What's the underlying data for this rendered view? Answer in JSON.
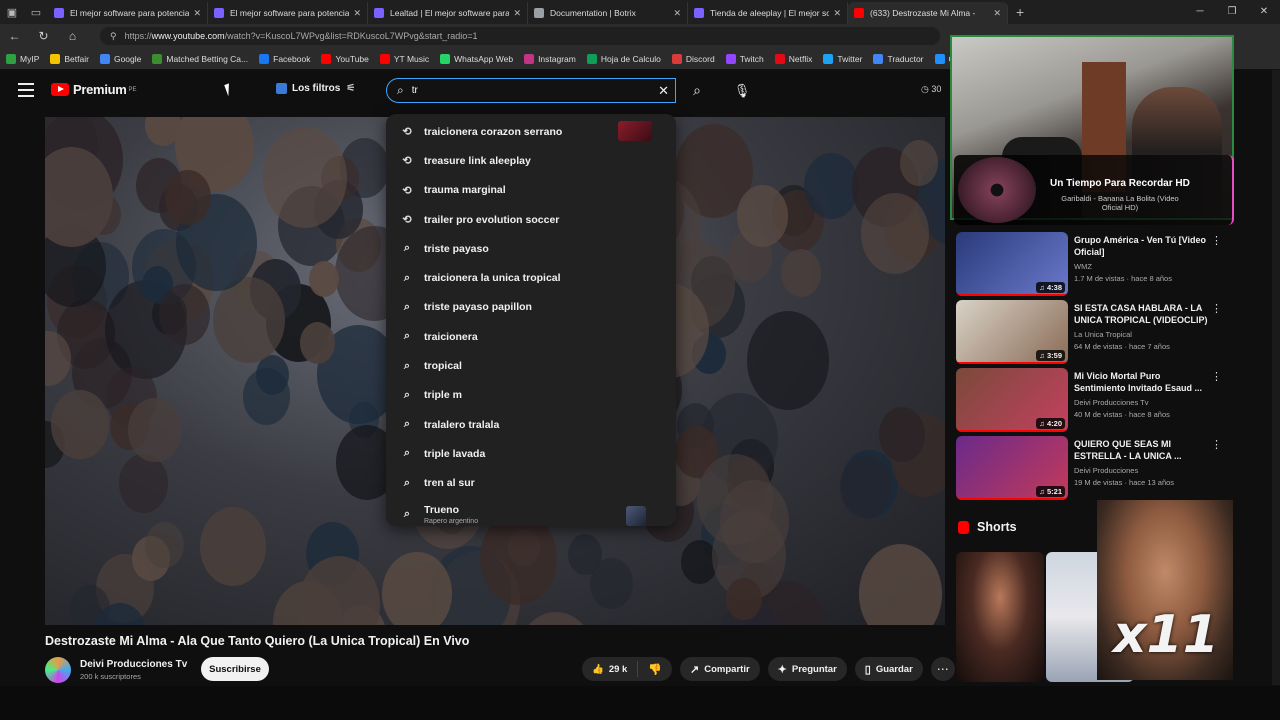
{
  "tabs": [
    {
      "title": "El mejor software para potenciar",
      "color": "#7b61ff"
    },
    {
      "title": "El mejor software para potenciar",
      "color": "#7b61ff"
    },
    {
      "title": "Lealtad | El mejor software para p",
      "color": "#7b61ff"
    },
    {
      "title": "Documentation | Botrix",
      "color": "#9aa0a6"
    },
    {
      "title": "Tienda de aleeplay | El mejor softw",
      "color": "#7b61ff"
    },
    {
      "title": "(633) Destrozaste Mi Alma -",
      "color": "#ff0000"
    }
  ],
  "address": {
    "prefix": "https://",
    "host": "www.youtube.com",
    "path": "/watch?v=KuscoL7WPvg&list=RDKuscoL7WPvg&start_radio=1"
  },
  "bookmarks": [
    {
      "label": "MyIP",
      "color": "#2ea043"
    },
    {
      "label": "Betfair",
      "color": "#f5c400"
    },
    {
      "label": "Google",
      "color": "#4285f4"
    },
    {
      "label": "Matched Betting Ca...",
      "color": "#3c8d2f"
    },
    {
      "label": "Facebook",
      "color": "#1877f2"
    },
    {
      "label": "YouTube",
      "color": "#ff0000"
    },
    {
      "label": "YT Music",
      "color": "#ff0000"
    },
    {
      "label": "WhatsApp Web",
      "color": "#25d366"
    },
    {
      "label": "Instagram",
      "color": "#c13584"
    },
    {
      "label": "Hoja de Calculo",
      "color": "#0f9d58"
    },
    {
      "label": "Discord",
      "color": "#d93b3b"
    },
    {
      "label": "Twitch",
      "color": "#9146ff"
    },
    {
      "label": "Netflix",
      "color": "#e50914"
    },
    {
      "label": "Twitter",
      "color": "#1da1f2"
    },
    {
      "label": "Traductor",
      "color": "#4285f4"
    },
    {
      "label": "Cinepl",
      "color": "#1e90ff"
    }
  ],
  "youtube": {
    "logo_text": "Premium",
    "logo_region": "PE",
    "filters_label": "Los filtros",
    "search_value": "tr",
    "counter_text": "30"
  },
  "suggestions": [
    {
      "text": "traicionera corazon serrano",
      "icon": "history",
      "thumb": true
    },
    {
      "text": "treasure link aleeplay",
      "icon": "history"
    },
    {
      "text": "trauma marginal",
      "icon": "history"
    },
    {
      "text": "trailer pro evolution soccer",
      "icon": "history"
    },
    {
      "text": "triste payaso",
      "icon": "search"
    },
    {
      "text": "traicionera la unica tropical",
      "icon": "search"
    },
    {
      "text": "triste payaso papillon",
      "icon": "search"
    },
    {
      "text": "traicionera",
      "icon": "search"
    },
    {
      "text": "tropical",
      "icon": "search"
    },
    {
      "text": "triple m",
      "icon": "search"
    },
    {
      "text": "tralalero tralala",
      "icon": "search"
    },
    {
      "text": "triple lavada",
      "icon": "search"
    },
    {
      "text": "tren al sur",
      "icon": "search"
    }
  ],
  "suggestion_rich": {
    "text": "Trueno",
    "sub": "Rapero argentino"
  },
  "video": {
    "title": "Destrozaste Mi Alma - Ala Que Tanto Quiero (La Unica Tropical) En Vivo",
    "channel": "Deivi Producciones Tv",
    "subs": "200 k suscriptores",
    "subscribe": "Suscribirse",
    "likes": "29 k",
    "share": "Compartir",
    "ask": "Preguntar",
    "save": "Guardar"
  },
  "now_playing": {
    "title": "Un Tiempo Para Recordar HD",
    "subtitle": "Garibaldi - Banana La Bolita (Video Oficial HD)"
  },
  "related": [
    {
      "title": "Grupo América - Ven Tú [Video Oficial]",
      "channel": "WMZ",
      "meta": "1.7 M de vistas · hace 8 años",
      "duration": "4:38",
      "colors": [
        "#2a3a7a",
        "#6a7acb"
      ]
    },
    {
      "title": "SI ESTA CASA HABLARA - LA UNICA TROPICAL (VIDEOCLIP)",
      "channel": "La Unica Tropical",
      "meta": "64 M de vistas · hace 7 años",
      "duration": "3:59",
      "colors": [
        "#d8d2c8",
        "#8a6b55"
      ]
    },
    {
      "title": "Mi Vicio Mortal Puro Sentimiento Invitado Esaud ...",
      "channel": "Deivi Producciones Tv",
      "meta": "40 M de vistas · hace 8 años",
      "duration": "4:20",
      "colors": [
        "#7a4a3a",
        "#c44060"
      ]
    },
    {
      "title": "QUIERO QUE SEAS MI ESTRELLA - LA UNICA ...",
      "channel": "Deivi Producciones",
      "meta": "19 M de vistas · hace 13 años",
      "duration": "5:21",
      "colors": [
        "#6a2a8a",
        "#c43a5a"
      ]
    }
  ],
  "shorts_label": "Shorts",
  "meme_text": "x11"
}
